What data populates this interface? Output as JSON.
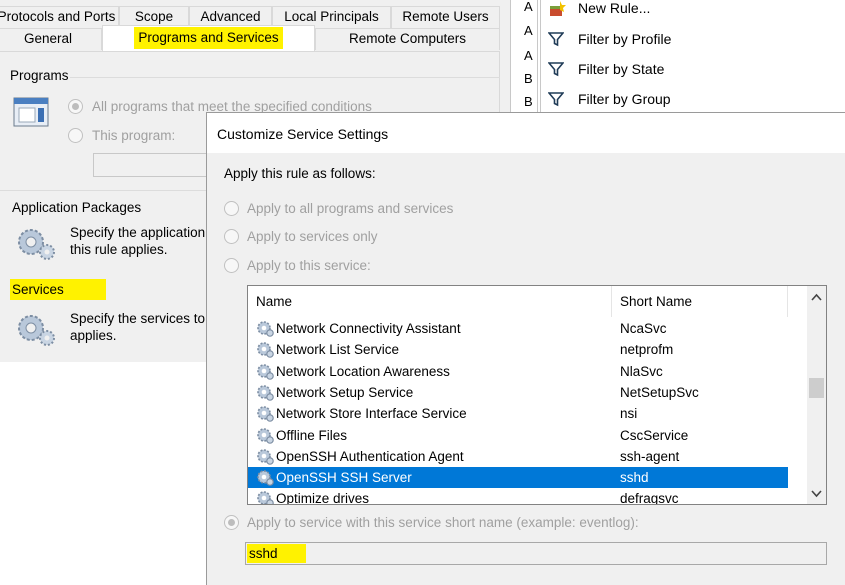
{
  "background_window": {
    "tabs_row1": [
      "Protocols and Ports",
      "Scope",
      "Advanced",
      "Local Principals",
      "Remote Users"
    ],
    "tabs_row2": [
      "General",
      "Programs and Services",
      "Remote Computers"
    ],
    "programs": {
      "title": "Programs",
      "option_all": "All programs that meet the specified conditions",
      "option_this": "This program:"
    },
    "app_packages": {
      "title": "Application Packages",
      "desc_line1": "Specify the application",
      "desc_line2": "this rule applies."
    },
    "services": {
      "title": "Services",
      "desc_line1": "Specify the services to",
      "desc_line2": "applies."
    }
  },
  "action_pane": {
    "letters": [
      "A",
      "A",
      "A",
      "B",
      "B"
    ],
    "actions": [
      {
        "label": "New Rule...",
        "icon": "new-rule-icon"
      },
      {
        "label": "Filter by Profile",
        "icon": "filter-icon"
      },
      {
        "label": "Filter by State",
        "icon": "filter-icon"
      },
      {
        "label": "Filter by Group",
        "icon": "filter-icon"
      }
    ]
  },
  "dialog": {
    "title": "Customize Service Settings",
    "apply_label": "Apply this rule as follows:",
    "option_all": "Apply to all programs and services",
    "option_services_only": "Apply to services only",
    "option_this_service": "Apply to this service:",
    "columns": {
      "name": "Name",
      "short": "Short Name"
    },
    "services": [
      {
        "name": "Network Connectivity Assistant",
        "short": "NcaSvc"
      },
      {
        "name": "Network List Service",
        "short": "netprofm"
      },
      {
        "name": "Network Location Awareness",
        "short": "NlaSvc"
      },
      {
        "name": "Network Setup Service",
        "short": "NetSetupSvc"
      },
      {
        "name": "Network Store Interface Service",
        "short": "nsi"
      },
      {
        "name": "Offline Files",
        "short": "CscService"
      },
      {
        "name": "OpenSSH Authentication Agent",
        "short": "ssh-agent"
      },
      {
        "name": "OpenSSH SSH Server",
        "short": "sshd",
        "selected": true
      },
      {
        "name": "Optimize drives",
        "short": "defragsvc"
      }
    ],
    "short_name_option": "Apply to service with this service short name (example: eventlog):",
    "short_name_value": "sshd"
  },
  "colors": {
    "highlight": "#fff200",
    "selection": "#0078d7"
  }
}
